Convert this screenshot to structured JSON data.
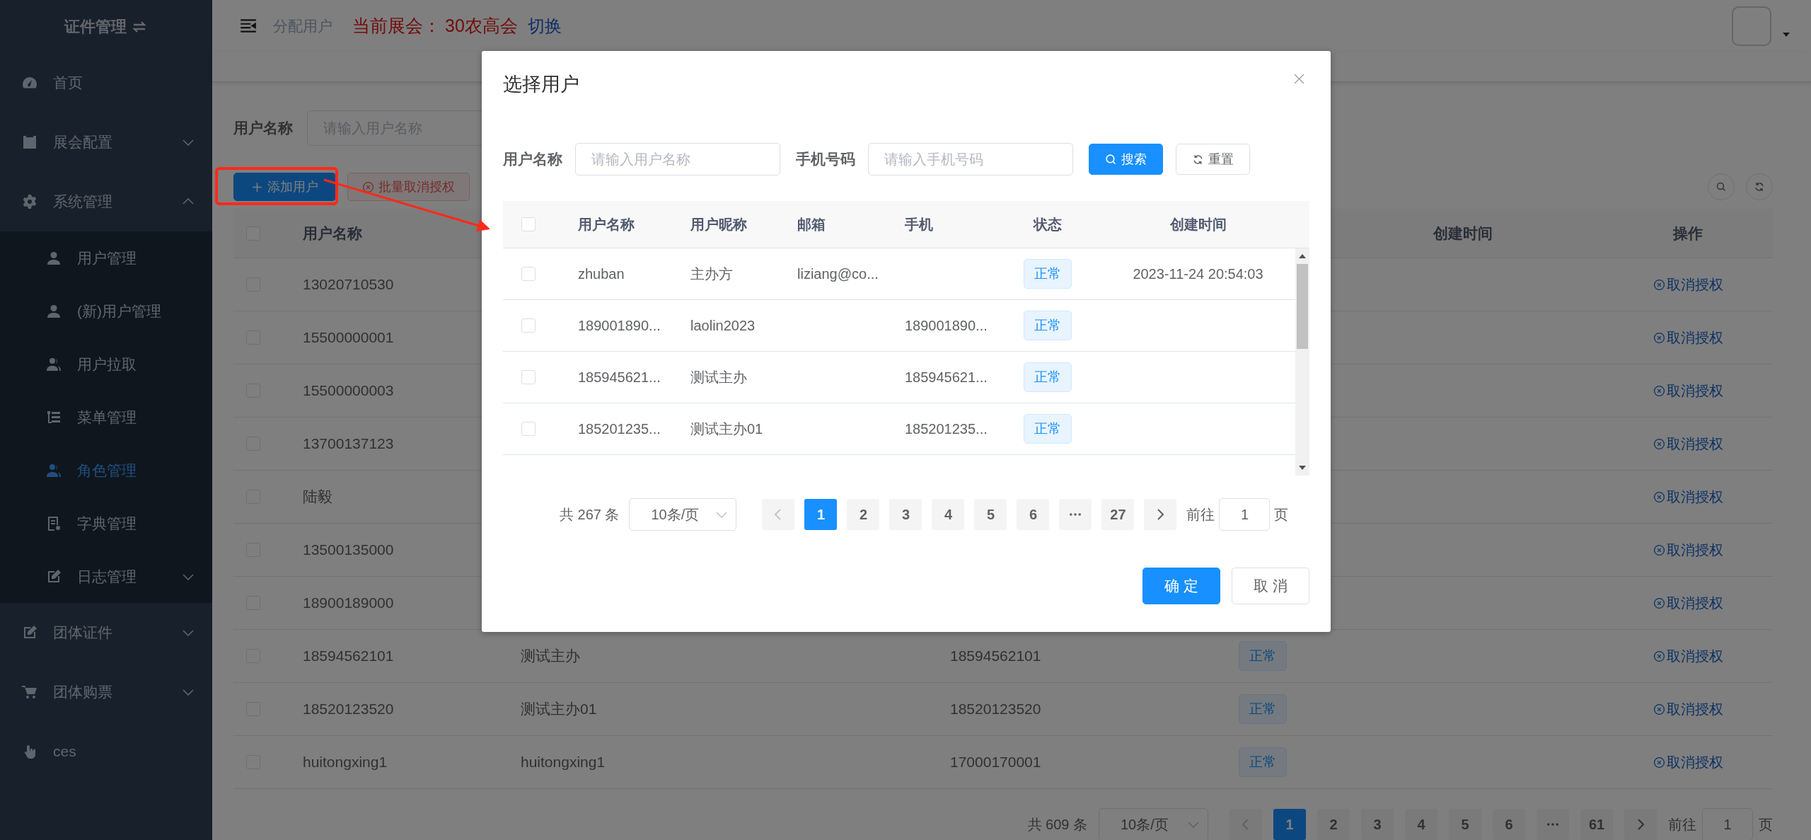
{
  "sidebar": {
    "title": "证件管理",
    "items": [
      {
        "label": "首页",
        "kind": "link",
        "selected": false
      },
      {
        "label": "展会配置",
        "kind": "group",
        "expanded": false,
        "selected": false
      },
      {
        "label": "系统管理",
        "kind": "group",
        "expanded": true,
        "selected": false,
        "children": [
          {
            "label": "用户管理",
            "kind": "link",
            "selected": false
          },
          {
            "label": "(新)用户管理",
            "kind": "link",
            "selected": false
          },
          {
            "label": "用户拉取",
            "kind": "link",
            "selected": false
          },
          {
            "label": "菜单管理",
            "kind": "link",
            "selected": false
          },
          {
            "label": "角色管理",
            "kind": "link",
            "selected": true
          },
          {
            "label": "字典管理",
            "kind": "link",
            "selected": false
          },
          {
            "label": "日志管理",
            "kind": "group",
            "expanded": false,
            "selected": false
          }
        ]
      },
      {
        "label": "团体证件",
        "kind": "group",
        "expanded": false,
        "selected": false
      },
      {
        "label": "团体购票",
        "kind": "group",
        "expanded": false,
        "selected": false
      },
      {
        "label": "ces",
        "kind": "link",
        "selected": false
      }
    ]
  },
  "header": {
    "breadcrumb": "分配用户",
    "exhibition_label": "当前展会：",
    "exhibition_name": "30农高会",
    "switch_link": "切换"
  },
  "search": {
    "label": "用户名称",
    "placeholder": "请输入用户名称"
  },
  "toolbar": {
    "add_button": "添加用户",
    "batch_button": "批量取消授权",
    "batch_disabled": true
  },
  "table": {
    "header_checked": false,
    "columns": [
      "用户名称",
      "创建时间",
      "操作"
    ],
    "rows": [
      {
        "checked": false,
        "username": "13020710530",
        "action": "取消授权"
      },
      {
        "checked": false,
        "username": "15500000001",
        "action": "取消授权"
      },
      {
        "checked": false,
        "username": "15500000003",
        "action": "取消授权"
      },
      {
        "checked": false,
        "username": "13700137123",
        "action": "取消授权"
      },
      {
        "checked": false,
        "username": "陆毅",
        "action": "取消授权"
      },
      {
        "checked": false,
        "username": "13500135000",
        "action": "取消授权"
      },
      {
        "checked": false,
        "username": "18900189000",
        "action": "取消授权"
      },
      {
        "checked": false,
        "username": "18594562101",
        "nickname": "测试主办",
        "phone": "18594562101",
        "status": "正常",
        "action": "取消授权"
      },
      {
        "checked": false,
        "username": "18520123520",
        "nickname": "测试主办01",
        "phone": "18520123520",
        "status": "正常",
        "action": "取消授权"
      },
      {
        "checked": false,
        "username": "huitongxing1",
        "nickname": "huitongxing1",
        "phone": "17000170001",
        "status": "正常",
        "action": "取消授权"
      }
    ]
  },
  "pagination": {
    "total": "共 609 条",
    "page_size": "10条/页",
    "prev_disabled": true,
    "pages": [
      {
        "kind": "page",
        "label": "1",
        "selected": true
      },
      {
        "kind": "page",
        "label": "2",
        "selected": false
      },
      {
        "kind": "page",
        "label": "3",
        "selected": false
      },
      {
        "kind": "page",
        "label": "4",
        "selected": false
      },
      {
        "kind": "page",
        "label": "5",
        "selected": false
      },
      {
        "kind": "page",
        "label": "6",
        "selected": false
      },
      {
        "kind": "more",
        "selected": false
      },
      {
        "kind": "page",
        "label": "61",
        "selected": false
      }
    ],
    "goto_label": "前往",
    "goto_value": "1",
    "goto_unit": "页"
  },
  "dialog": {
    "title": "选择用户",
    "fields": [
      {
        "label": "用户名称",
        "placeholder": "请输入用户名称"
      },
      {
        "label": "手机号码",
        "placeholder": "请输入手机号码"
      }
    ],
    "search_button": "搜索",
    "reset_button": "重置",
    "header_checked": false,
    "columns": [
      "用户名称",
      "用户昵称",
      "邮箱",
      "手机",
      "状态",
      "创建时间"
    ],
    "rows": [
      {
        "checked": false,
        "username": "zhuban",
        "nickname": "主办方",
        "email": "liziang@co...",
        "status": "正常",
        "created": "2023-11-24 20:54:03"
      },
      {
        "checked": false,
        "username": "189001890...",
        "nickname": "laolin2023",
        "phone": "189001890...",
        "status": "正常"
      },
      {
        "checked": false,
        "username": "185945621...",
        "nickname": "测试主办",
        "phone": "185945621...",
        "status": "正常"
      },
      {
        "checked": false,
        "username": "185201235...",
        "nickname": "测试主办01",
        "phone": "185201235...",
        "status": "正常"
      }
    ],
    "pagination": {
      "total": "共 267 条",
      "page_size": "10条/页",
      "prev_disabled": true,
      "pages": [
        {
          "kind": "page",
          "label": "1",
          "selected": true
        },
        {
          "kind": "page",
          "label": "2",
          "selected": false
        },
        {
          "kind": "page",
          "label": "3",
          "selected": false
        },
        {
          "kind": "page",
          "label": "4",
          "selected": false
        },
        {
          "kind": "page",
          "label": "5",
          "selected": false
        },
        {
          "kind": "page",
          "label": "6",
          "selected": false
        },
        {
          "kind": "more",
          "selected": false
        },
        {
          "kind": "page",
          "label": "27",
          "selected": false
        }
      ],
      "goto_label": "前往",
      "goto_value": "1",
      "goto_unit": "页"
    },
    "confirm_button": "确 定",
    "cancel_button": "取 消"
  }
}
